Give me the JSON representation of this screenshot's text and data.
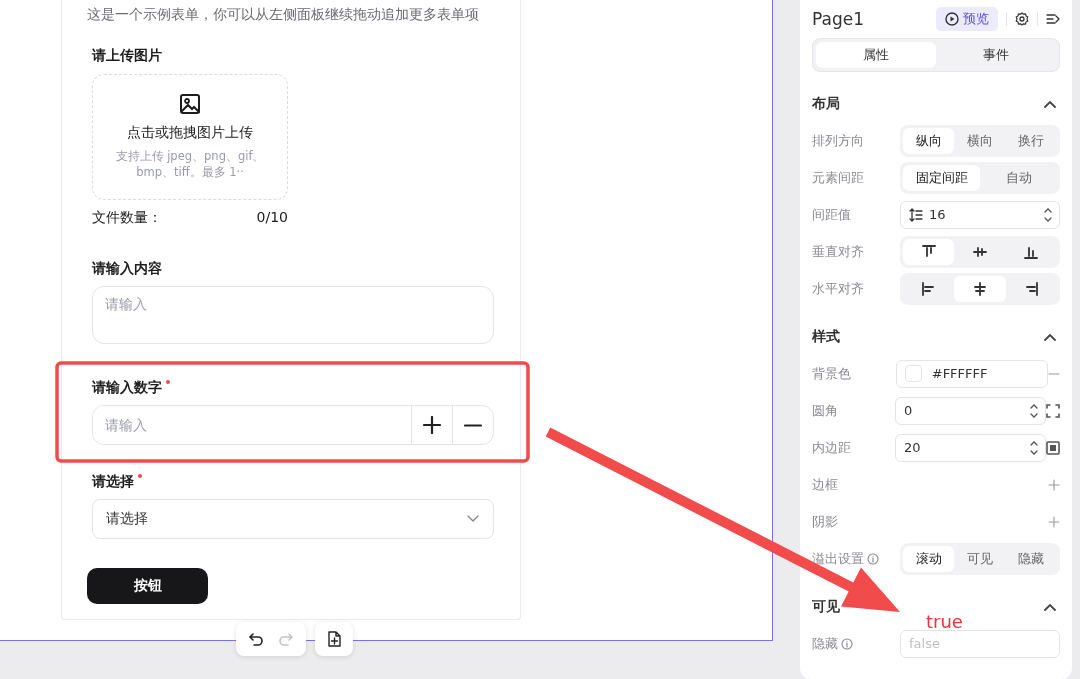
{
  "form": {
    "description": "这是一个示例表单，你可以从左侧面板继续拖动追加更多表单项",
    "fields": [
      {
        "kind": "upload",
        "label": "请上传图片",
        "required": false,
        "title": "点击或拖拽图片上传",
        "hint": "支持上传 jpeg、png、gif、bmp、tiff。最多 1··",
        "count_label": "文件数量：",
        "count": "0/10"
      },
      {
        "kind": "textarea",
        "label": "请输入内容",
        "required": false,
        "placeholder": "请输入"
      },
      {
        "kind": "number",
        "label": "请输入数字",
        "required": true,
        "placeholder": "请输入"
      },
      {
        "kind": "select",
        "label": "请选择",
        "required": true,
        "value": "请选择"
      }
    ],
    "button": "按钮"
  },
  "toolbar": {
    "redo_disabled": true
  },
  "panel": {
    "title": "Page1",
    "preview": "预览",
    "tabs": [
      {
        "label": "属性",
        "selected": true
      },
      {
        "label": "事件",
        "selected": false
      }
    ],
    "sections": [
      {
        "title": "布局",
        "expanded": true,
        "rows": [
          {
            "kind": "segmented",
            "label": "排列方向",
            "options": [
              {
                "label": "纵向",
                "selected": true
              },
              {
                "label": "横向",
                "selected": false
              },
              {
                "label": "换行",
                "selected": false
              }
            ]
          },
          {
            "kind": "segmented",
            "label": "元素间距",
            "options": [
              {
                "label": "固定间距",
                "selected": true
              },
              {
                "label": "自动",
                "selected": false
              }
            ]
          },
          {
            "kind": "spacing-stepper",
            "label": "间距值",
            "value": "16"
          },
          {
            "kind": "valign",
            "label": "垂直对齐",
            "options": [
              {
                "selected": true
              },
              {
                "selected": false
              },
              {
                "selected": false
              }
            ]
          },
          {
            "kind": "halign",
            "label": "水平对齐",
            "options": [
              {
                "selected": false
              },
              {
                "selected": true
              },
              {
                "selected": false
              }
            ]
          }
        ]
      },
      {
        "title": "样式",
        "expanded": true,
        "rows": [
          {
            "kind": "color",
            "label": "背景色",
            "value": "#FFFFFF",
            "color": "#ffffff"
          },
          {
            "kind": "radius-stepper",
            "label": "圆角",
            "value": "0"
          },
          {
            "kind": "padding-stepper",
            "label": "内边距",
            "value": "20"
          },
          {
            "kind": "add",
            "label": "边框"
          },
          {
            "kind": "add",
            "label": "阴影"
          },
          {
            "kind": "segmented",
            "label": "溢出设置",
            "info": true,
            "options": [
              {
                "label": "滚动",
                "selected": true
              },
              {
                "label": "可见",
                "selected": false
              },
              {
                "label": "隐藏",
                "selected": false
              }
            ]
          }
        ]
      },
      {
        "title": "可见",
        "expanded": true,
        "rows": [
          {
            "kind": "text",
            "label": "隐藏",
            "info": true,
            "placeholder": "false"
          }
        ]
      }
    ]
  },
  "annotation": {
    "text": "true"
  }
}
